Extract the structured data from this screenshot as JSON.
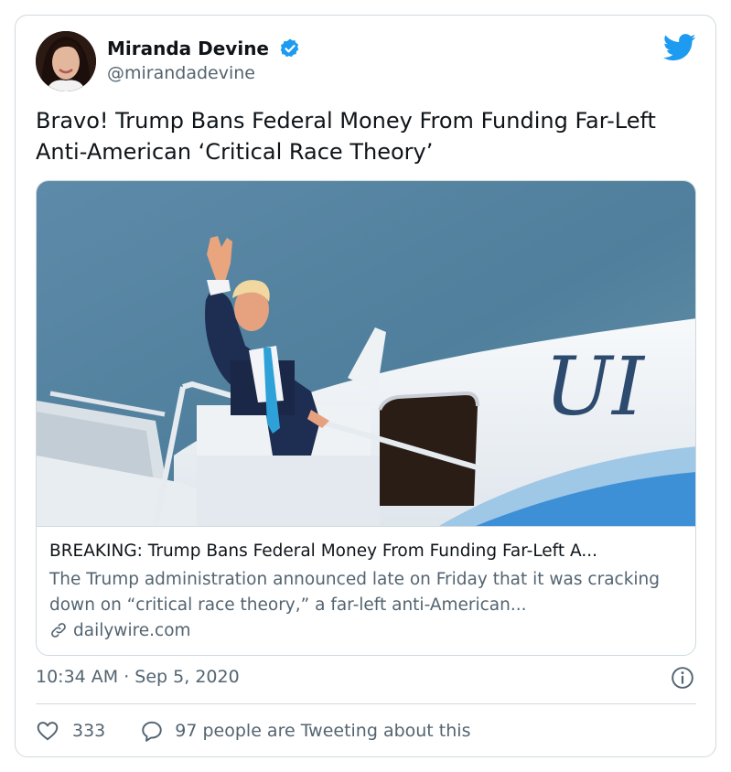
{
  "author": {
    "name": "Miranda Devine",
    "handle": "@mirandadevine"
  },
  "tweet": {
    "text": "Bravo! Trump Bans Federal Money From Funding Far-Left Anti-American ‘Critical Race Theory’",
    "timestamp": "10:34 AM · Sep 5, 2020"
  },
  "link_card": {
    "title": "BREAKING: Trump Bans Federal Money From Funding Far-Left A...",
    "description": "The Trump administration announced late on Friday that it was cracking down on “critical race theory,” a far-left anti-American...",
    "domain": "dailywire.com",
    "image_lettering": "UI"
  },
  "engagement": {
    "likes": "333",
    "tweeting_about": "97 people are Tweeting about this"
  },
  "icons": {
    "verified": "verified-badge-icon",
    "brand": "twitter-bird-icon",
    "link": "link-icon",
    "info": "info-icon",
    "like": "heart-icon",
    "reply": "speech-bubble-icon"
  },
  "colors": {
    "brand_blue": "#1d9bf0",
    "text_primary": "#0f1419",
    "text_secondary": "#536471",
    "border": "#cfd9de"
  }
}
